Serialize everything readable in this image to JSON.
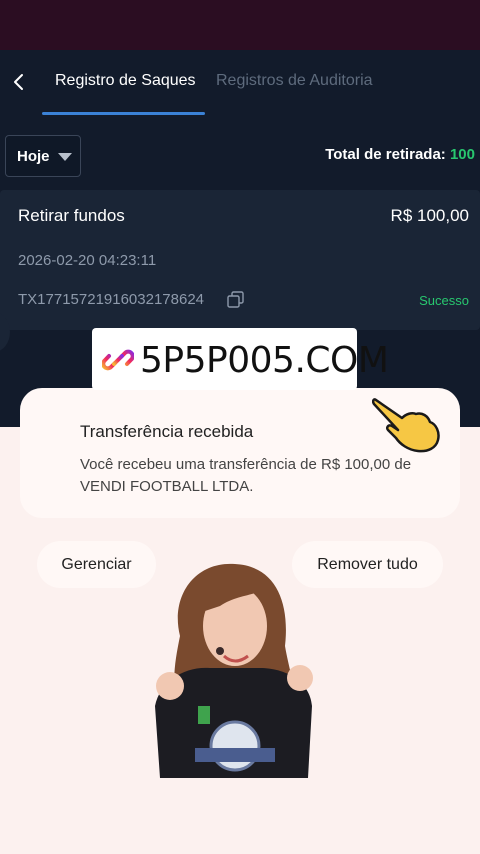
{
  "header": {
    "back_icon": "chevron-left-icon",
    "tabs": [
      {
        "label": "Registro de Saques",
        "active": true
      },
      {
        "label": "Registros de Auditoria",
        "active": false
      }
    ]
  },
  "filter": {
    "selected": "Hoje",
    "icon": "caret-down-icon"
  },
  "total": {
    "label": "Total de retirada:",
    "value": "100"
  },
  "record": {
    "title": "Retirar fundos",
    "amount": "R$ 100,00",
    "datetime": "2026-02-20 04:23:11",
    "tx_id": "TX17715721916032178624",
    "status": "Sucesso"
  },
  "watermark": {
    "text": "5P5P005.COM",
    "icon": "link-icon"
  },
  "notification": {
    "title": "Transferência recebida",
    "body": "Você recebeu uma transferência de R$ 100,00 de VENDI FOOTBALL LTDA."
  },
  "actions": {
    "manage": "Gerenciar",
    "remove_all": "Remover tudo"
  },
  "colors": {
    "accent_green": "#28c76f",
    "tab_underline": "#3b82d6",
    "panel_bg": "#121b2b"
  }
}
